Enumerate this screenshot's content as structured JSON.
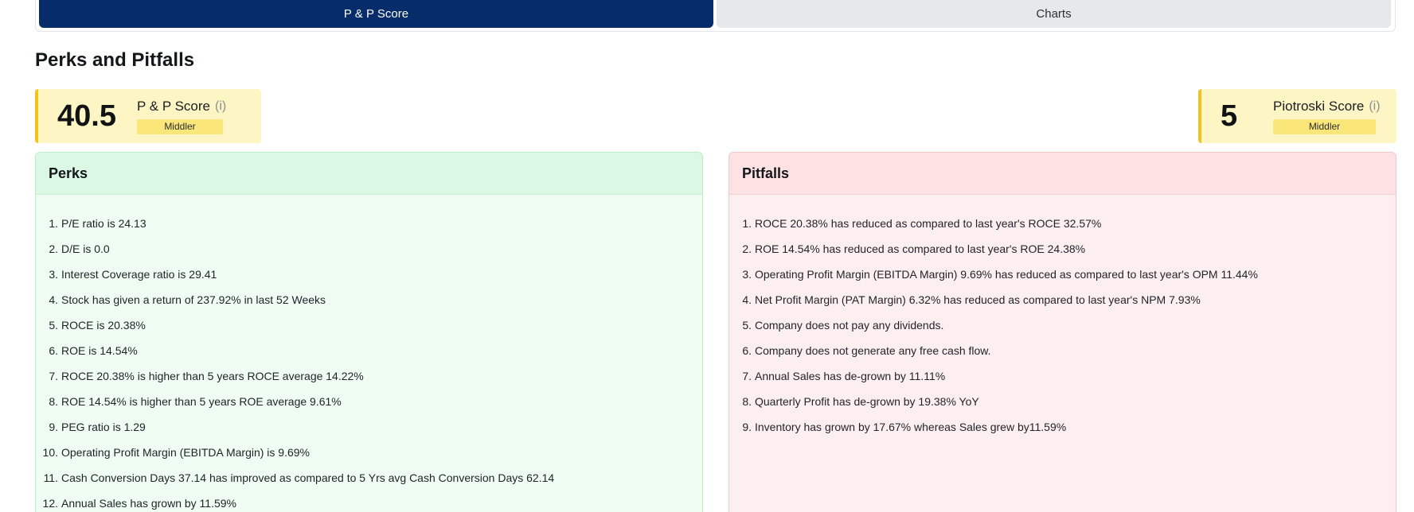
{
  "tabs": [
    {
      "label": "P & P Score",
      "active": true
    },
    {
      "label": "Charts",
      "active": false
    }
  ],
  "page_title": "Perks and Pitfalls",
  "pp_score": {
    "value": "40.5",
    "label": "P & P Score",
    "info": "(i)",
    "badge": "Middler"
  },
  "piotroski_score": {
    "value": "5",
    "label": "Piotroski Score",
    "info": "(i)",
    "badge": "Middler"
  },
  "perks": {
    "title": "Perks",
    "items": [
      {
        "num": "1.",
        "text": "P/E ratio is 24.13"
      },
      {
        "num": "2.",
        "text": "D/E is 0.0"
      },
      {
        "num": "3.",
        "text": "Interest Coverage ratio is 29.41"
      },
      {
        "num": "4.",
        "text": "Stock has given a return of 237.92% in last 52 Weeks"
      },
      {
        "num": "5.",
        "text": "ROCE is 20.38%"
      },
      {
        "num": "6.",
        "text": "ROE is 14.54%"
      },
      {
        "num": "7.",
        "text": "ROCE 20.38% is higher than 5 years ROCE average 14.22%"
      },
      {
        "num": "8.",
        "text": "ROE 14.54% is higher than 5 years ROE average 9.61%"
      },
      {
        "num": "9.",
        "text": "PEG ratio is 1.29"
      },
      {
        "num": "10.",
        "text": "Operating Profit Margin (EBITDA Margin) is 9.69%"
      },
      {
        "num": "11.",
        "text": "Cash Conversion Days 37.14 has improved as compared to 5 Yrs avg Cash Conversion Days 62.14"
      },
      {
        "num": "12.",
        "text": "Annual Sales has grown by 11.59%"
      }
    ]
  },
  "pitfalls": {
    "title": "Pitfalls",
    "items": [
      {
        "num": "1.",
        "text": "ROCE 20.38% has reduced as compared to last year's ROCE 32.57%"
      },
      {
        "num": "2.",
        "text": "ROE 14.54% has reduced as compared to last year's ROE 24.38%"
      },
      {
        "num": "3.",
        "text": "Operating Profit Margin (EBITDA Margin) 9.69% has reduced as compared to last year's OPM 11.44%"
      },
      {
        "num": "4.",
        "text": "Net Profit Margin (PAT Margin) 6.32% has reduced as compared to last year's NPM 7.93%"
      },
      {
        "num": "5.",
        "text": "Company does not pay any dividends."
      },
      {
        "num": "6.",
        "text": "Company does not generate any free cash flow."
      },
      {
        "num": "7.",
        "text": "Annual Sales has de-grown by 11.11%"
      },
      {
        "num": "8.",
        "text": "Quarterly Profit has de-grown by 19.38% YoY"
      },
      {
        "num": "9.",
        "text": "Inventory has grown by 17.67% whereas Sales grew by11.59%"
      }
    ]
  },
  "colors": {
    "active_tab": "#062c69",
    "perks_bg": "#effdf3",
    "pitfalls_bg": "#fdeff0",
    "score_card_bg": "#fdf5c4",
    "score_accent": "#f2c31a",
    "badge_bg": "#fbe67a"
  }
}
